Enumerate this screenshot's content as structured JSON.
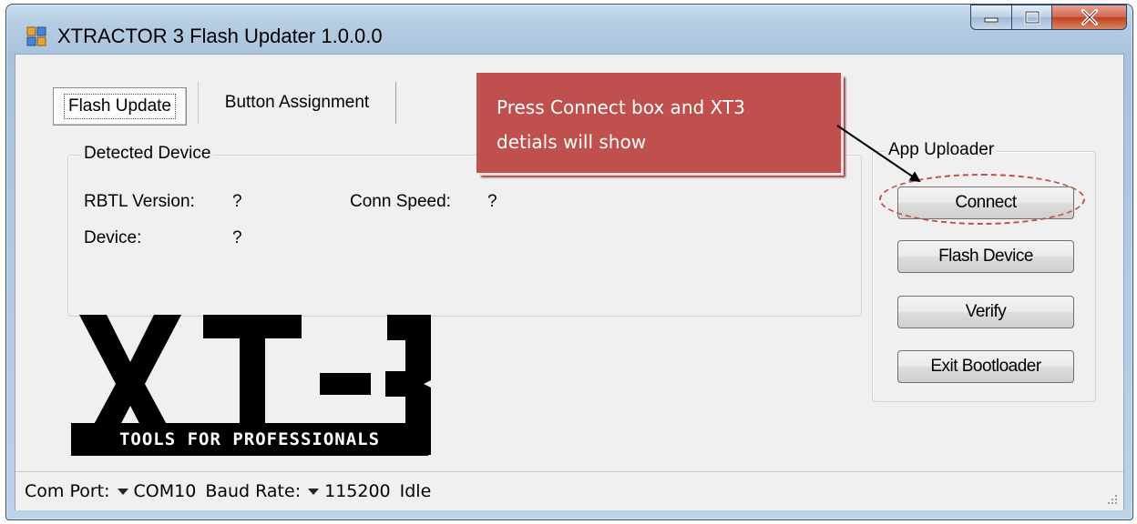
{
  "window": {
    "title": "XTRACTOR 3 Flash Updater 1.0.0.0",
    "colors": {
      "titlebar": "#b6cde3",
      "close_button": "#c2401f",
      "client_bg": "#f0f0f0"
    }
  },
  "tabs": [
    {
      "label": "Flash Update",
      "selected": true
    },
    {
      "label": "Button Assignment",
      "selected": false
    }
  ],
  "detected_device": {
    "legend": "Detected Device",
    "rbtl_label": "RBTL Version:",
    "rbtl_value": "?",
    "conn_speed_label": "Conn Speed:",
    "conn_speed_value": "?",
    "device_label": "Device:",
    "device_value": "?"
  },
  "app_uploader": {
    "legend": "App Uploader",
    "connect": "Connect",
    "flash_device": "Flash Device",
    "verify": "Verify",
    "exit_bootloader": "Exit Bootloader"
  },
  "callout": {
    "line1": "Press Connect box and XT3",
    "line2": "detials will show",
    "color": "#c0504d"
  },
  "logo": {
    "text": "XT-3",
    "tagline": "TOOLS FOR PROFESSIONALS"
  },
  "statusbar": {
    "com_port_label": "Com Port:",
    "com_port_value": "COM10",
    "baud_label": "Baud Rate:",
    "baud_value": "115200",
    "status": "Idle"
  }
}
